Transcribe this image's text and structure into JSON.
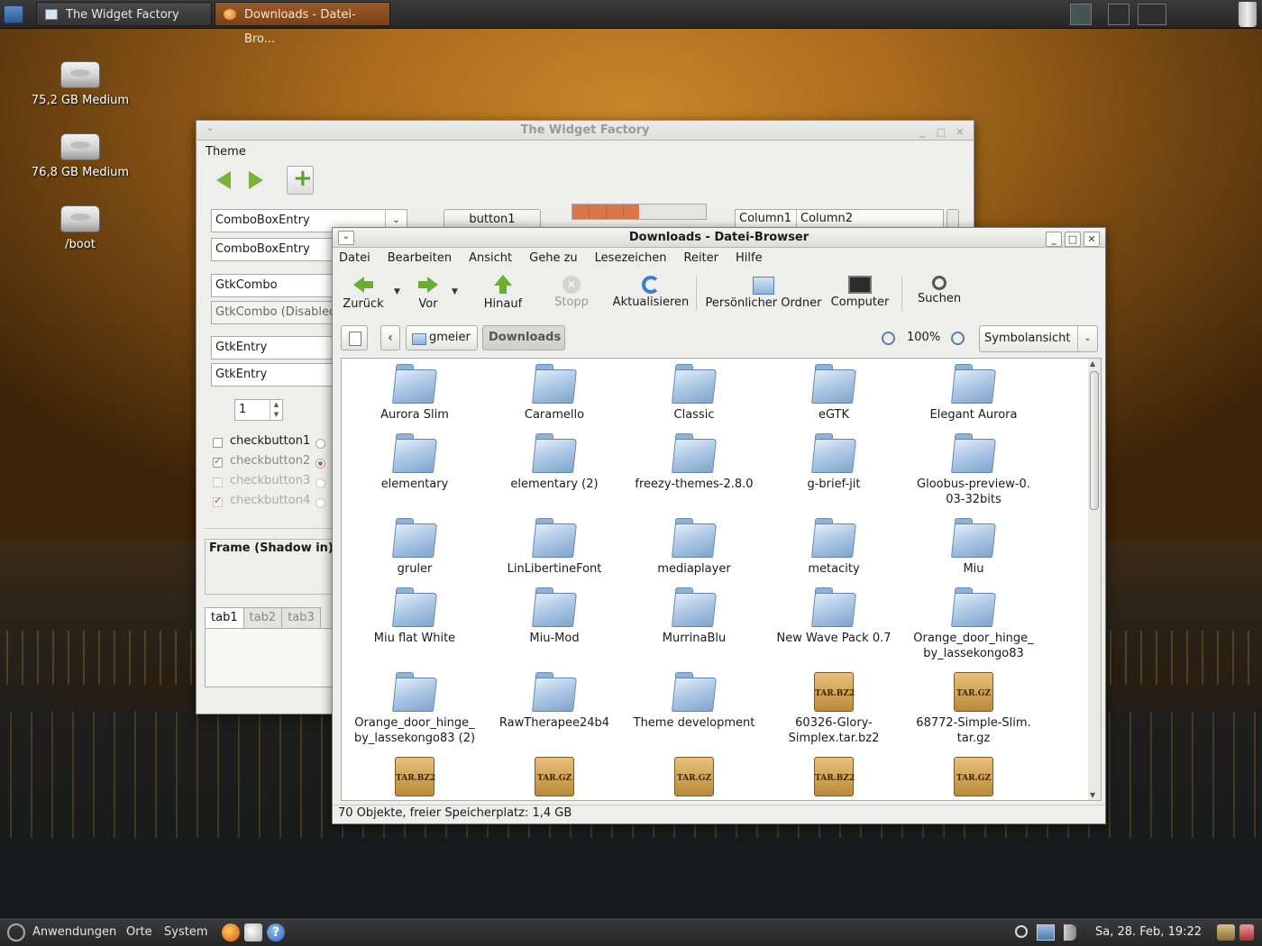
{
  "top_panel": {
    "tasks": [
      {
        "title": "The Widget Factory"
      },
      {
        "title": "Downloads - Datei-Bro..."
      }
    ]
  },
  "desktop_icons": [
    {
      "label": "75,2 GB Medium"
    },
    {
      "label": "76,8 GB Medium"
    },
    {
      "label": "/boot"
    }
  ],
  "widget_factory": {
    "title": "The Widget Factory",
    "theme_label": "Theme",
    "combo1": "ComboBoxEntry",
    "combo2": "ComboBoxEntry",
    "gtkcombo": "GtkCombo",
    "gtkcombo_disabled": "GtkCombo (Disabled",
    "entry1": "GtkEntry",
    "entry2": "GtkEntry",
    "button1": "button1",
    "progress_fraction": 0.5,
    "tree_col1": "Column1",
    "tree_col2": "Column2",
    "spin_value": "1",
    "checks": [
      {
        "label": "checkbutton1",
        "checked": false,
        "disabled": false
      },
      {
        "label": "checkbutton2",
        "checked": true,
        "disabled": false
      },
      {
        "label": "checkbutton3",
        "checked": false,
        "disabled": true
      },
      {
        "label": "checkbutton4",
        "checked": true,
        "disabled": true
      }
    ],
    "frame_title": "Frame (Shadow in)",
    "tabs": [
      "tab1",
      "tab2",
      "tab3"
    ]
  },
  "file_browser": {
    "title": "Downloads - Datei-Browser",
    "menu": [
      {
        "label": "Datei"
      },
      {
        "label": "Bearbeiten"
      },
      {
        "label": "Ansicht"
      },
      {
        "label": "Gehe zu"
      },
      {
        "label": "Lesezeichen"
      },
      {
        "label": "Reiter"
      },
      {
        "label": "Hilfe"
      }
    ],
    "toolbar": {
      "back": "Zurück",
      "forward": "Vor",
      "up": "Hinauf",
      "stop": "Stopp",
      "reload": "Aktualisieren",
      "home": "Persönlicher Ordner",
      "computer": "Computer",
      "search": "Suchen"
    },
    "path": {
      "home": "gmeier",
      "current": "Downloads"
    },
    "zoom": "100%",
    "view_mode": "Symbolansicht",
    "items": [
      {
        "name": "Aurora Slim",
        "type": "folder"
      },
      {
        "name": "Caramello",
        "type": "folder"
      },
      {
        "name": "Classic",
        "type": "folder"
      },
      {
        "name": "eGTK",
        "type": "folder"
      },
      {
        "name": "Elegant Aurora",
        "type": "folder"
      },
      {
        "name": "elementary",
        "type": "folder"
      },
      {
        "name": "elementary (2)",
        "type": "folder"
      },
      {
        "name": "freezy-themes-2.8.0",
        "type": "folder"
      },
      {
        "name": "g-brief-jit",
        "type": "folder"
      },
      {
        "name": "Gloobus-preview-0.03-32bits",
        "line1": "Gloobus-preview-0.",
        "line2": "03-32bits",
        "type": "folder"
      },
      {
        "name": "gruler",
        "type": "folder"
      },
      {
        "name": "LinLibertineFont",
        "type": "folder"
      },
      {
        "name": "mediaplayer",
        "type": "folder"
      },
      {
        "name": "metacity",
        "type": "folder"
      },
      {
        "name": "Miu",
        "type": "folder"
      },
      {
        "name": "Miu flat White",
        "type": "folder"
      },
      {
        "name": "Miu-Mod",
        "type": "folder"
      },
      {
        "name": "MurrinaBlu",
        "type": "folder"
      },
      {
        "name": "New Wave Pack 0.7",
        "type": "folder"
      },
      {
        "name": "Orange_door_hinge_by_lassekongo83",
        "line1": "Orange_door_hinge_",
        "line2": "by_lassekongo83",
        "type": "folder"
      },
      {
        "name": "Orange_door_hinge_by_lassekongo83 (2)",
        "line1": "Orange_door_hinge_",
        "line2": "by_lassekongo83 (2)",
        "type": "folder"
      },
      {
        "name": "RawTherapee24b4",
        "type": "folder"
      },
      {
        "name": "Theme development",
        "type": "folder"
      },
      {
        "name": "60326-Glory-Simplex.tar.bz2",
        "line1": "60326-Glory-",
        "line2": "Simplex.tar.bz2",
        "type": "archive",
        "badge": "TAR.BZ2"
      },
      {
        "name": "68772-Simple-Slim.tar.gz",
        "line1": "68772-Simple-Slim.",
        "line2": "tar.gz",
        "type": "archive",
        "badge": "TAR.GZ"
      },
      {
        "name": "",
        "type": "archive",
        "badge": "TAR.BZ2"
      },
      {
        "name": "",
        "type": "archive",
        "badge": "TAR.GZ"
      },
      {
        "name": "",
        "type": "archive",
        "badge": "TAR.GZ"
      },
      {
        "name": "",
        "type": "archive",
        "badge": "TAR.BZ2"
      },
      {
        "name": "",
        "type": "archive",
        "badge": "TAR.GZ"
      }
    ],
    "status": "70 Objekte, freier Speicherplatz: 1,4 GB"
  },
  "bottom_panel": {
    "apps": "Anwendungen",
    "places": "Orte",
    "system": "System",
    "help_glyph": "?",
    "clock": "Sa, 28. Feb, 19:22"
  },
  "icons": {
    "menu": "main-menu-icon",
    "foot": "gnome-foot-icon",
    "firefox": "firefox-icon",
    "mail": "mail-icon",
    "help": "help-icon",
    "folder": "folder-icon",
    "archive": "archive-icon"
  },
  "colors": {
    "accent": "#c9683a",
    "folder": "#8fb2d7",
    "toolbar_green": "#6aae34"
  }
}
